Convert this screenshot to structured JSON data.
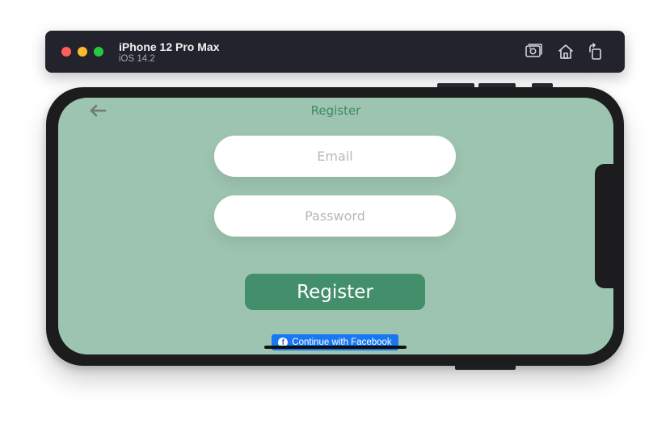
{
  "simulator": {
    "device_name": "iPhone 12 Pro Max",
    "os_version": "iOS 14.2",
    "toolbar_icons": [
      "screenshot-icon",
      "home-icon",
      "rotate-icon"
    ]
  },
  "app": {
    "nav_title": "Register",
    "back_icon": "arrow-left-icon",
    "email_placeholder": "Email",
    "password_placeholder": "Password",
    "register_label": "Register",
    "facebook_label": "Continue with Facebook",
    "facebook_logo": "f"
  },
  "colors": {
    "screen_background": "#9dc4b0",
    "accent": "#438e6b",
    "title_text": "#3d8a66",
    "facebook_blue": "#1877f2",
    "titlebar": "#23232d"
  }
}
